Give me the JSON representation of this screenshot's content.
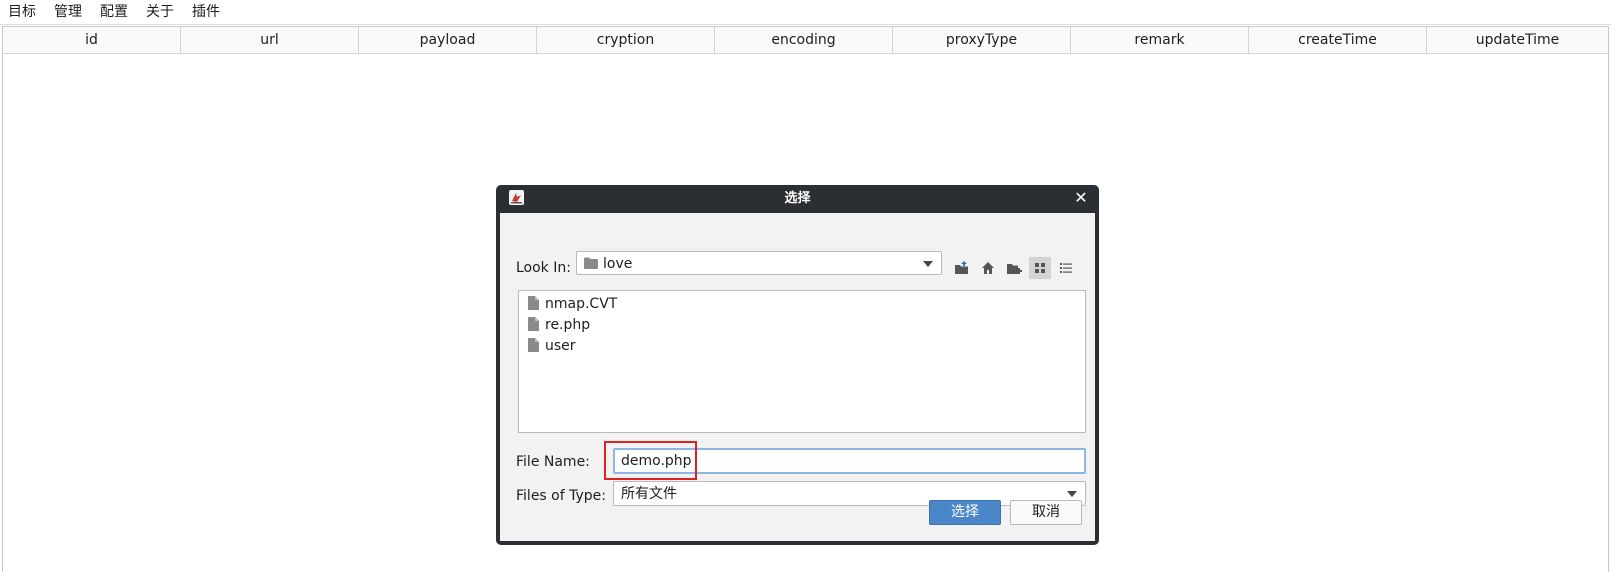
{
  "menubar": {
    "items": [
      "目标",
      "管理",
      "配置",
      "关于",
      "插件"
    ]
  },
  "table": {
    "columns": [
      "id",
      "url",
      "payload",
      "cryption",
      "encoding",
      "proxyType",
      "remark",
      "createTime",
      "updateTime"
    ],
    "rows": []
  },
  "dialog": {
    "title": "选择",
    "close_glyph": "✕",
    "look_in_label": "Look In:",
    "look_in_value": "love",
    "toolbar_icons": [
      "up-folder-icon",
      "home-icon",
      "new-folder-icon",
      "list-view-icon",
      "details-view-icon"
    ],
    "files": [
      {
        "name": "nmap.CVT",
        "icon": "file-icon"
      },
      {
        "name": "re.php",
        "icon": "file-icon"
      },
      {
        "name": "user",
        "icon": "file-icon"
      }
    ],
    "file_name_label": "File Name:",
    "file_name_value": "demo.php",
    "files_of_type_label": "Files of Type:",
    "files_of_type_value": "所有文件",
    "ok_label": "选择",
    "cancel_label": "取消"
  },
  "colors": {
    "title_bar": "#2b2e33",
    "primary_button": "#4a86c8",
    "input_focus_border": "#8db6e2",
    "highlight_box": "#e02020"
  }
}
